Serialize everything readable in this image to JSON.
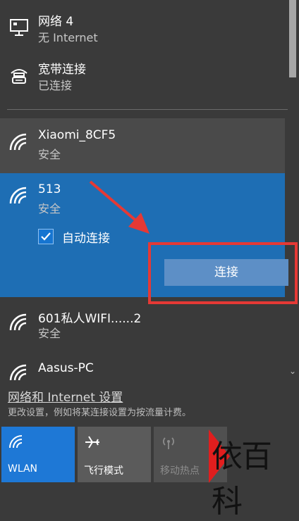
{
  "networks": {
    "ethernet": {
      "name": "网络 4",
      "status": "无 Internet"
    },
    "broadband": {
      "name": "宽带连接",
      "status": "已连接"
    },
    "wifi_list": [
      {
        "name": "Xiaomi_8CF5",
        "status": "安全"
      },
      {
        "name": "513",
        "status": "安全",
        "auto_connect_label": "自动连接",
        "auto_connect_checked": true,
        "connect_label": "连接"
      },
      {
        "name": "601私人WIFI......2",
        "status": "安全"
      },
      {
        "name": "Aasus-PC"
      }
    ]
  },
  "settings": {
    "link_text": "网络和 Internet 设置",
    "description": "更改设置，例如将某连接设置为按流量计费。"
  },
  "quick_actions": [
    {
      "label": "WLAN",
      "icon": "wifi-icon",
      "active": true
    },
    {
      "label": "飞行模式",
      "icon": "airplane-icon",
      "active": false
    },
    {
      "label": "移动热点",
      "icon": "hotspot-icon",
      "active": false,
      "disabled": true
    }
  ],
  "watermark": {
    "text": "依百科"
  },
  "colors": {
    "selected_band": "#1e6eb4",
    "connect_button": "#5d8fc6",
    "annotation": "#e53935",
    "wlan_tile": "#1e78d6"
  }
}
